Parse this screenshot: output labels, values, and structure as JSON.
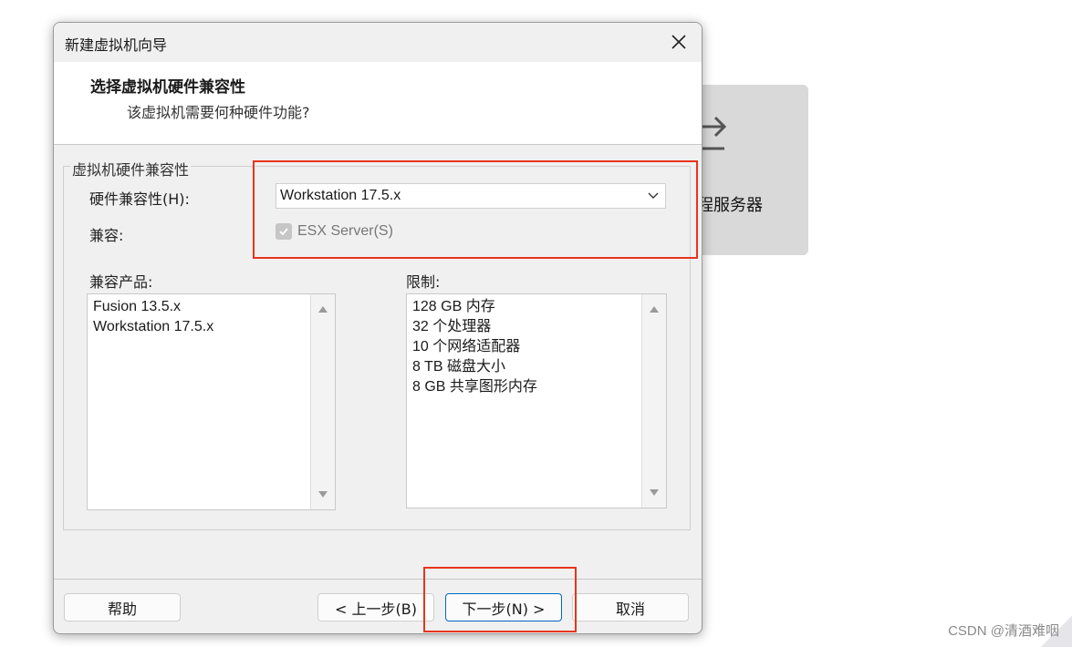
{
  "background": {
    "card_label": "程服务器",
    "watermark": "CSDN @清酒难咽"
  },
  "dialog": {
    "title": "新建虚拟机向导",
    "header_title": "选择虚拟机硬件兼容性",
    "header_subtitle": "该虚拟机需要何种硬件功能?",
    "group_label": "虚拟机硬件兼容性",
    "hardware_label": "硬件兼容性(H):",
    "hardware_value": "Workstation 17.5.x",
    "compatible_label": "兼容:",
    "esx_label": "ESX Server(S)",
    "esx_checked": true,
    "esx_disabled": true,
    "products_label": "兼容产品:",
    "products": [
      "Fusion 13.5.x",
      "Workstation 17.5.x"
    ],
    "limits_label": "限制:",
    "limits": [
      "128 GB 内存",
      "32 个处理器",
      "10 个网络适配器",
      "8 TB 磁盘大小",
      "8 GB 共享图形内存"
    ],
    "buttons": {
      "help": "帮助",
      "back": "< 上一步(B)",
      "next": "下一步(N) >",
      "cancel": "取消"
    }
  },
  "colors": {
    "highlight": "#e8341c",
    "primary_border": "#0067c0"
  }
}
